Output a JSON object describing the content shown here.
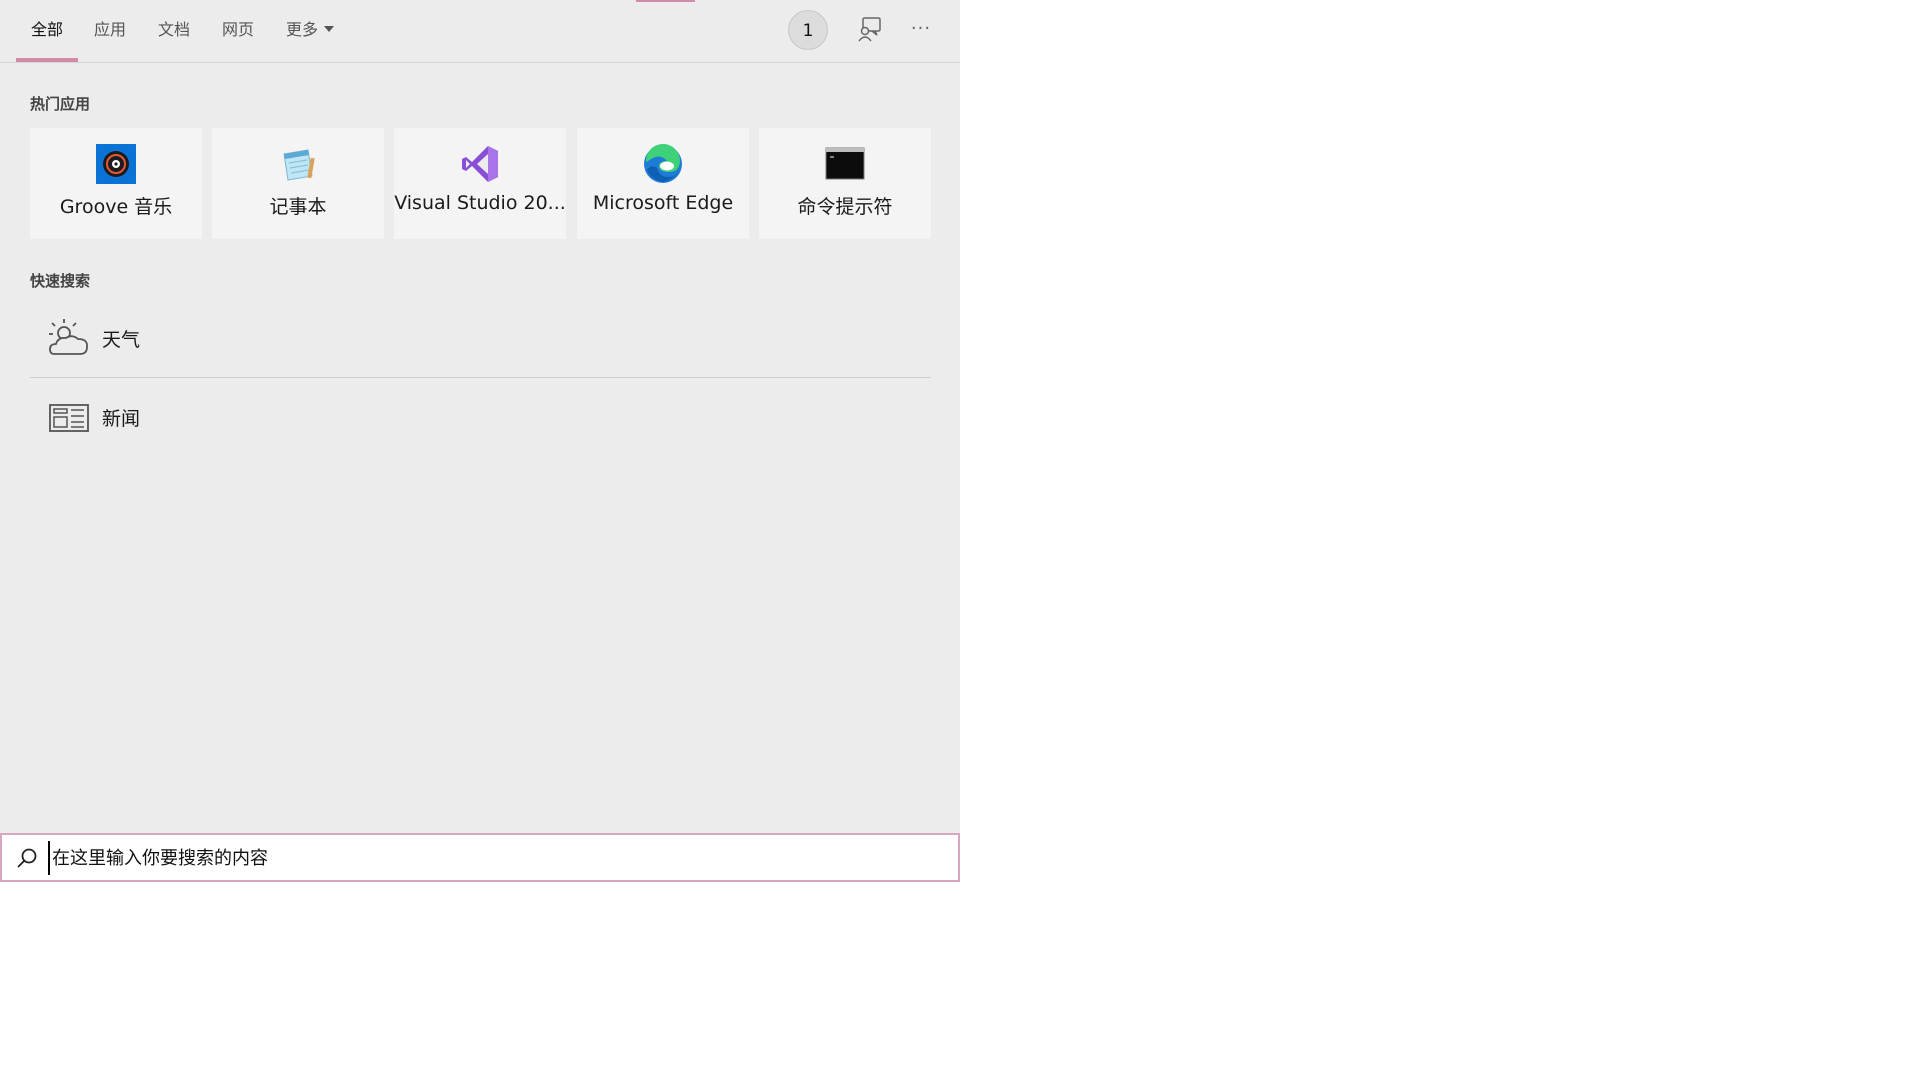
{
  "tabs": [
    {
      "label": "全部",
      "active": true
    },
    {
      "label": "应用",
      "active": false
    },
    {
      "label": "文档",
      "active": false
    },
    {
      "label": "网页",
      "active": false
    },
    {
      "label": "更多",
      "active": false
    }
  ],
  "header": {
    "rewards_count": "1",
    "feedback_icon": "feedback-icon",
    "more_options_label": "···"
  },
  "top_apps": {
    "heading": "热门应用",
    "items": [
      {
        "label": "Groove 音乐",
        "icon": "groove-music-icon"
      },
      {
        "label": "记事本",
        "icon": "notepad-icon"
      },
      {
        "label": "Visual Studio 20...",
        "icon": "visual-studio-icon"
      },
      {
        "label": "Microsoft Edge",
        "icon": "edge-icon"
      },
      {
        "label": "命令提示符",
        "icon": "command-prompt-icon"
      }
    ]
  },
  "quick_search": {
    "heading": "快速搜索",
    "items": [
      {
        "label": "天气",
        "icon": "weather-icon"
      },
      {
        "label": "新闻",
        "icon": "news-icon"
      }
    ]
  },
  "search": {
    "placeholder": "在这里输入你要搜索的内容",
    "value": ""
  },
  "colors": {
    "accent": "#d08aaa",
    "panel_bg": "#ececec",
    "tile_bg": "#f4f4f4"
  }
}
